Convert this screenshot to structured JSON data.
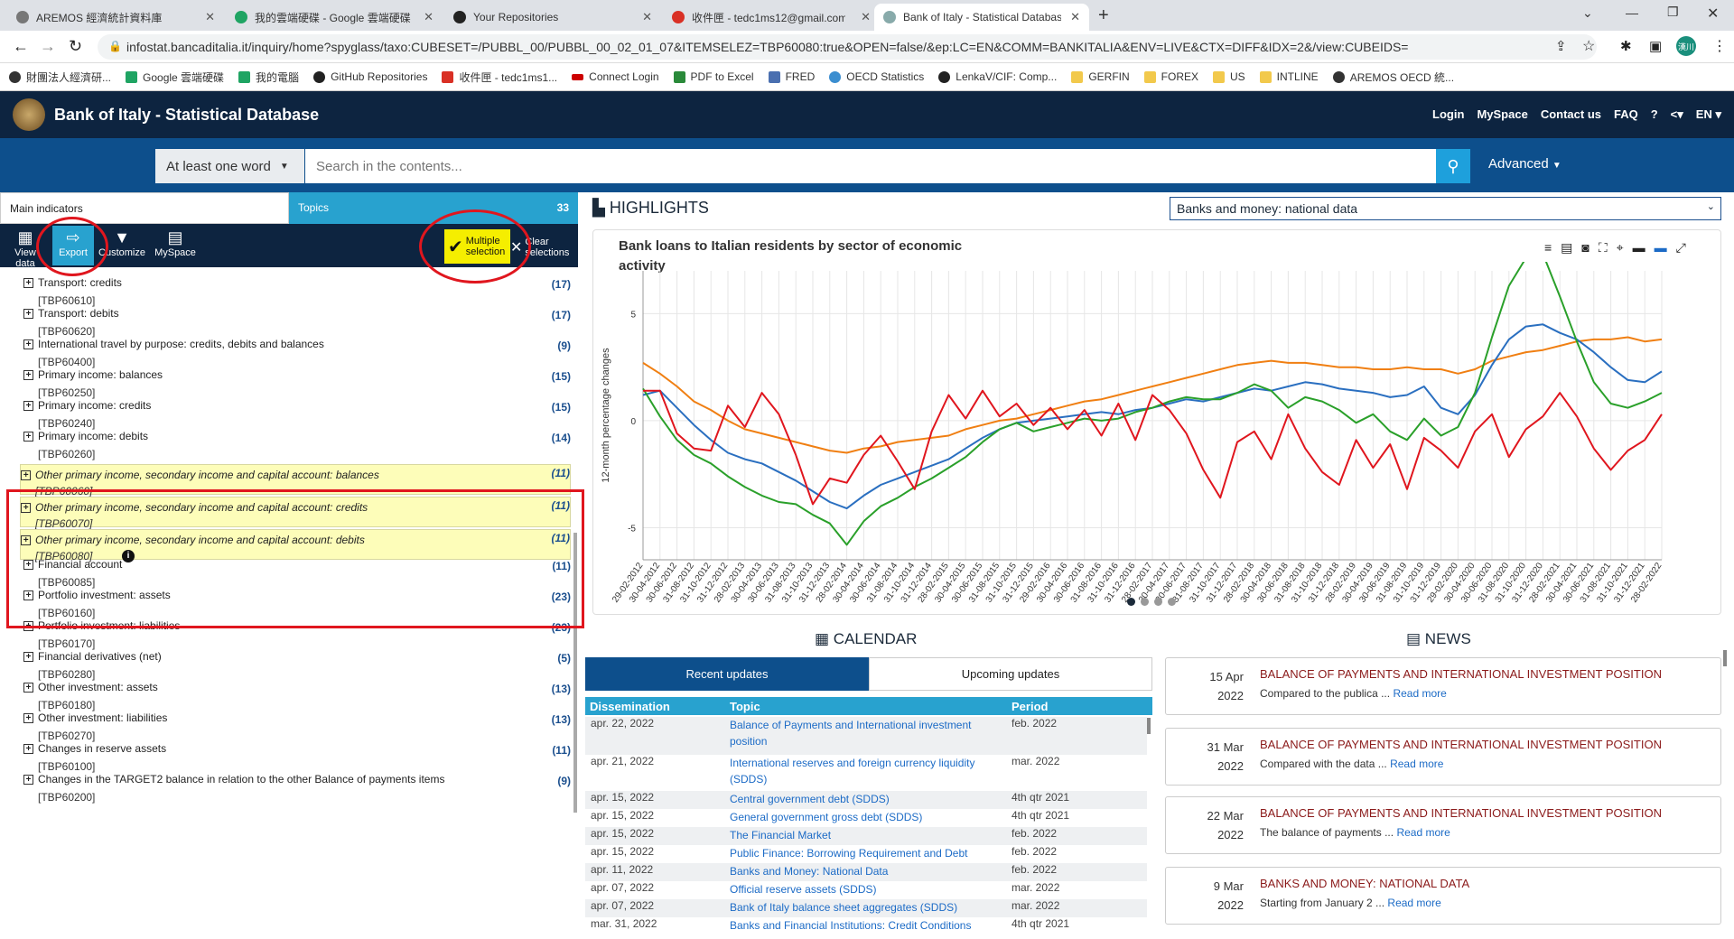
{
  "browser": {
    "tabs": [
      {
        "title": "AREMOS 經濟統計資料庫",
        "color": "#777"
      },
      {
        "title": "我的雲端硬碟 - Google 雲端硬碟",
        "color": "#1fa463"
      },
      {
        "title": "Your Repositories",
        "color": "#222"
      },
      {
        "title": "收件匣 - tedc1ms12@gmail.com",
        "color": "#d93025"
      },
      {
        "title": "Bank of Italy - Statistical Database",
        "color": "#8aa"
      }
    ],
    "url": "infostat.bancaditalia.it/inquiry/home?spyglass/taxo:CUBESET=/PUBBL_00/PUBBL_00_02_01_07&ITEMSELEZ=TBP60080:true&OPEN=false/&ep:LC=EN&COMM=BANKITALIA&ENV=LIVE&CTX=DIFF&IDX=2&/view:CUBEIDS=",
    "bookmarks": [
      "財團法人經濟研...",
      "Google 雲端硬碟",
      "我的電腦",
      "GitHub Repositories",
      "收件匣 - tedc1ms1...",
      "Connect Login",
      "PDF to Excel",
      "FRED",
      "OECD Statistics",
      "LenkaV/CIF: Comp...",
      "GERFIN",
      "FOREX",
      "US",
      "INTLINE",
      "AREMOS OECD 統..."
    ],
    "avatar": "漢川"
  },
  "site": {
    "title": "Bank of Italy - Statistical Database",
    "nav": [
      "Login",
      "MySpace",
      "Contact us",
      "FAQ",
      "?",
      "EN"
    ],
    "search": {
      "mode": "At least one word",
      "placeholder": "Search in the contents...",
      "advanced": "Advanced"
    }
  },
  "left": {
    "tab_main": "Main indicators",
    "tab_topics": "Topics",
    "topics_count": "33",
    "toolbar": {
      "view": "View data",
      "export": "Export",
      "customize": "Customize",
      "myspace": "MySpace",
      "multiple": "Multiple selection",
      "clear": "Clear selections"
    },
    "items": [
      {
        "label": "Transport: credits",
        "code": "[TBP60610]",
        "count": "(17)"
      },
      {
        "label": "Transport: debits",
        "code": "[TBP60620]",
        "count": "(17)"
      },
      {
        "label": "International travel by purpose: credits, debits and balances",
        "code": "[TBP60400]",
        "count": "(9)"
      },
      {
        "label": "Primary income: balances",
        "code": "[TBP60250]",
        "count": "(15)"
      },
      {
        "label": "Primary income: credits",
        "code": "[TBP60240]",
        "count": "(15)"
      },
      {
        "label": "Primary income: debits",
        "code": "[TBP60260]",
        "count": "(14)"
      },
      {
        "label": "Other primary income, secondary income and capital account: balances",
        "code": "[TBP60060]",
        "count": "(11)"
      },
      {
        "label": "Other primary income, secondary income and capital account: credits",
        "code": "[TBP60070]",
        "count": "(11)"
      },
      {
        "label": "Other primary income, secondary income and capital account: debits",
        "code": "[TBP60080]",
        "count": "(11)"
      },
      {
        "label": "Financial account",
        "code": "[TBP60085]",
        "count": "(11)"
      },
      {
        "label": "Portfolio investment: assets",
        "code": "[TBP60160]",
        "count": "(23)"
      },
      {
        "label": "Portfolio investment: liabilities",
        "code": "[TBP60170]",
        "count": "(23)"
      },
      {
        "label": "Financial derivatives (net)",
        "code": "[TBP60280]",
        "count": "(5)"
      },
      {
        "label": "Other investment: assets",
        "code": "[TBP60180]",
        "count": "(13)"
      },
      {
        "label": "Other investment: liabilities",
        "code": "[TBP60270]",
        "count": "(13)"
      },
      {
        "label": "Changes in reserve assets",
        "code": "[TBP60100]",
        "count": "(11)"
      },
      {
        "label": "Changes in the TARGET2 balance in relation to the other Balance of payments items",
        "code": "[TBP60200]",
        "count": "(9)"
      }
    ]
  },
  "highlights": {
    "heading": "HIGHLIGHTS",
    "select": "Banks and money: national data"
  },
  "chart_data": {
    "type": "line",
    "title": "Bank loans to Italian residents by sector of economic activity",
    "ylabel": "12-month percentage changes",
    "ylim": [
      -6.5,
      7
    ],
    "yticks": [
      -5,
      0,
      5
    ],
    "x": [
      "29-02-2012",
      "30-04-2012",
      "30-06-2012",
      "31-08-2012",
      "31-10-2012",
      "31-12-2012",
      "28-02-2013",
      "30-04-2013",
      "30-06-2013",
      "31-08-2013",
      "31-10-2013",
      "31-12-2013",
      "28-02-2014",
      "30-04-2014",
      "30-06-2014",
      "31-08-2014",
      "31-10-2014",
      "31-12-2014",
      "28-02-2015",
      "30-04-2015",
      "30-06-2015",
      "31-08-2015",
      "31-10-2015",
      "31-12-2015",
      "29-02-2016",
      "30-04-2016",
      "30-06-2016",
      "31-08-2016",
      "31-10-2016",
      "31-12-2016",
      "28-02-2017",
      "30-04-2017",
      "30-06-2017",
      "31-08-2017",
      "31-10-2017",
      "31-12-2017",
      "28-02-2018",
      "30-04-2018",
      "30-06-2018",
      "31-08-2018",
      "31-10-2018",
      "31-12-2018",
      "28-02-2019",
      "30-04-2019",
      "30-06-2019",
      "31-08-2019",
      "31-10-2019",
      "31-12-2019",
      "29-02-2020",
      "30-04-2020",
      "30-06-2020",
      "31-08-2020",
      "31-10-2020",
      "31-12-2020",
      "28-02-2021",
      "30-04-2021",
      "30-06-2021",
      "31-08-2021",
      "31-10-2021",
      "31-12-2021",
      "28-02-2022"
    ],
    "series": [
      {
        "color": "#f07f12",
        "values": [
          2.7,
          2.2,
          1.6,
          0.9,
          0.5,
          0,
          -0.4,
          -0.6,
          -0.8,
          -1,
          -1.2,
          -1.4,
          -1.5,
          -1.3,
          -1.2,
          -1,
          -0.9,
          -0.8,
          -0.7,
          -0.4,
          -0.2,
          0,
          0.1,
          0.3,
          0.5,
          0.7,
          0.9,
          1,
          1.2,
          1.4,
          1.6,
          1.8,
          2,
          2.2,
          2.4,
          2.6,
          2.7,
          2.8,
          2.7,
          2.7,
          2.6,
          2.5,
          2.5,
          2.4,
          2.4,
          2.5,
          2.4,
          2.4,
          2.2,
          2.4,
          2.8,
          3,
          3.2,
          3.3,
          3.5,
          3.7,
          3.8,
          3.8,
          3.9,
          3.7,
          3.8
        ]
      },
      {
        "color": "#2a6fc0",
        "values": [
          1.2,
          1.4,
          0.6,
          -0.2,
          -0.9,
          -1.5,
          -1.8,
          -2,
          -2.4,
          -2.8,
          -3.3,
          -3.8,
          -4.1,
          -3.5,
          -3,
          -2.7,
          -2.4,
          -2.1,
          -1.8,
          -1.3,
          -0.8,
          -0.4,
          -0.1,
          0,
          0.1,
          0.2,
          0.3,
          0.4,
          0.3,
          0.5,
          0.6,
          0.8,
          1,
          0.9,
          1.1,
          1.3,
          1.5,
          1.4,
          1.6,
          1.8,
          1.7,
          1.5,
          1.4,
          1.3,
          1.1,
          1.2,
          1.6,
          0.6,
          0.3,
          1.2,
          2.6,
          3.8,
          4.4,
          4.5,
          4.1,
          3.8,
          3.2,
          2.5,
          1.9,
          1.8,
          2.3
        ]
      },
      {
        "color": "#2aa02a",
        "values": [
          1.5,
          0.2,
          -0.9,
          -1.6,
          -2,
          -2.6,
          -3.1,
          -3.5,
          -3.8,
          -3.9,
          -4.4,
          -4.8,
          -5.8,
          -4.7,
          -4,
          -3.6,
          -3.1,
          -2.7,
          -2.2,
          -1.7,
          -1,
          -0.4,
          -0.1,
          -0.5,
          -0.3,
          -0.1,
          0.1,
          0,
          0.1,
          0.4,
          0.6,
          0.9,
          1.1,
          1,
          1,
          1.3,
          1.7,
          1.4,
          0.6,
          1.1,
          0.9,
          0.5,
          -0.1,
          0.3,
          -0.5,
          -0.9,
          0.1,
          -0.7,
          -0.3,
          1.3,
          3.9,
          6.3,
          7.6,
          7.8,
          5.8,
          3.7,
          1.8,
          0.8,
          0.6,
          0.9,
          1.3
        ]
      },
      {
        "color": "#e0161e",
        "values": [
          1.4,
          1.4,
          -0.6,
          -1.3,
          -1.4,
          0.7,
          -0.3,
          1.3,
          0.3,
          -1.6,
          -3.9,
          -2.7,
          -2.9,
          -1.6,
          -0.7,
          -1.9,
          -3.2,
          -0.5,
          1.2,
          0.1,
          1.4,
          0.2,
          0.8,
          -0.2,
          0.6,
          -0.4,
          0.5,
          -0.7,
          0.8,
          -0.9,
          1.2,
          0.5,
          -0.6,
          -2.3,
          -3.6,
          -1,
          -0.5,
          -1.8,
          0.3,
          -1.3,
          -2.4,
          -3,
          -0.9,
          -2.2,
          -1.1,
          -3.2,
          -0.8,
          -1.4,
          -2.2,
          -0.5,
          0.3,
          -1.7,
          -0.4,
          0.2,
          1.3,
          0.2,
          -1.3,
          -2.3,
          -1.4,
          -0.9,
          0.3
        ]
      }
    ],
    "grid": true,
    "legend": "none"
  },
  "calendar": {
    "heading": "CALENDAR",
    "tab_recent": "Recent updates",
    "tab_upcoming": "Upcoming updates",
    "cols": [
      "Dissemination",
      "Topic",
      "Period"
    ],
    "rows": [
      {
        "date": "apr. 22, 2022",
        "topic": "Balance of Payments and International investment position",
        "period": "feb. 2022"
      },
      {
        "date": "apr. 21, 2022",
        "topic": "International reserves and foreign currency liquidity (SDDS)",
        "period": "mar. 2022"
      },
      {
        "date": "apr. 15, 2022",
        "topic": "Central government debt (SDDS)",
        "period": "4th qtr 2021"
      },
      {
        "date": "apr. 15, 2022",
        "topic": "General government gross debt (SDDS)",
        "period": "4th qtr 2021"
      },
      {
        "date": "apr. 15, 2022",
        "topic": "The Financial Market",
        "period": "feb. 2022"
      },
      {
        "date": "apr. 15, 2022",
        "topic": "Public Finance: Borrowing Requirement and Debt",
        "period": "feb. 2022"
      },
      {
        "date": "apr. 11, 2022",
        "topic": "Banks and Money: National Data",
        "period": "feb. 2022"
      },
      {
        "date": "apr. 07, 2022",
        "topic": "Official reserve assets (SDDS)",
        "period": "mar. 2022"
      },
      {
        "date": "apr. 07, 2022",
        "topic": "Bank of Italy balance sheet aggregates (SDDS)",
        "period": "mar. 2022"
      },
      {
        "date": "mar. 31, 2022",
        "topic": "Banks and Financial Institutions: Credit Conditions",
        "period": "4th qtr 2021"
      }
    ]
  },
  "news": {
    "heading": "NEWS",
    "read_more": "Read more",
    "items": [
      {
        "day": "15 Apr",
        "year": "2022",
        "title": "BALANCE OF PAYMENTS AND INTERNATIONAL INVESTMENT POSITION",
        "snippet": "Compared to the publica ..."
      },
      {
        "day": "31 Mar",
        "year": "2022",
        "title": "BALANCE OF PAYMENTS AND INTERNATIONAL INVESTMENT POSITION",
        "snippet": "Compared with the data ..."
      },
      {
        "day": "22 Mar",
        "year": "2022",
        "title": "BALANCE OF PAYMENTS AND INTERNATIONAL INVESTMENT POSITION",
        "snippet": "The balance of payments ..."
      },
      {
        "day": "9 Mar",
        "year": "2022",
        "title": "BANKS AND MONEY: NATIONAL DATA",
        "snippet": "Starting from January 2 ..."
      }
    ]
  }
}
